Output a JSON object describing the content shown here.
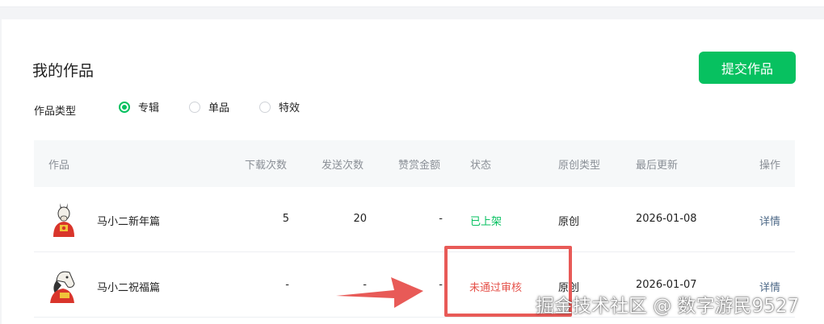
{
  "page": {
    "title": "我的作品",
    "submit_label": "提交作品",
    "type_label": "作品类型",
    "type_options": [
      {
        "label": "专辑",
        "checked": true
      },
      {
        "label": "单品",
        "checked": false
      },
      {
        "label": "特效",
        "checked": false
      }
    ]
  },
  "table": {
    "headers": [
      "作品",
      "下载次数",
      "发送次数",
      "赞赏金额",
      "状态",
      "原创类型",
      "最后更新",
      "操作"
    ],
    "rows": [
      {
        "name": "马小二新年篇",
        "downloads": "5",
        "sends": "20",
        "reward": "-",
        "status": "已上架",
        "original": "原创",
        "updated": "2026-01-08",
        "action": "详情"
      },
      {
        "name": "马小二祝福篇",
        "downloads": "-",
        "sends": "-",
        "reward": "-",
        "status": "未通过审核",
        "original": "原创",
        "updated": "2026-01-07",
        "action": "详情"
      }
    ]
  },
  "colors": {
    "accent": "#07c160",
    "error": "#e5534b",
    "highlight": "#e85a57"
  },
  "watermark": "掘金技术社区 @ 数字游民9527"
}
